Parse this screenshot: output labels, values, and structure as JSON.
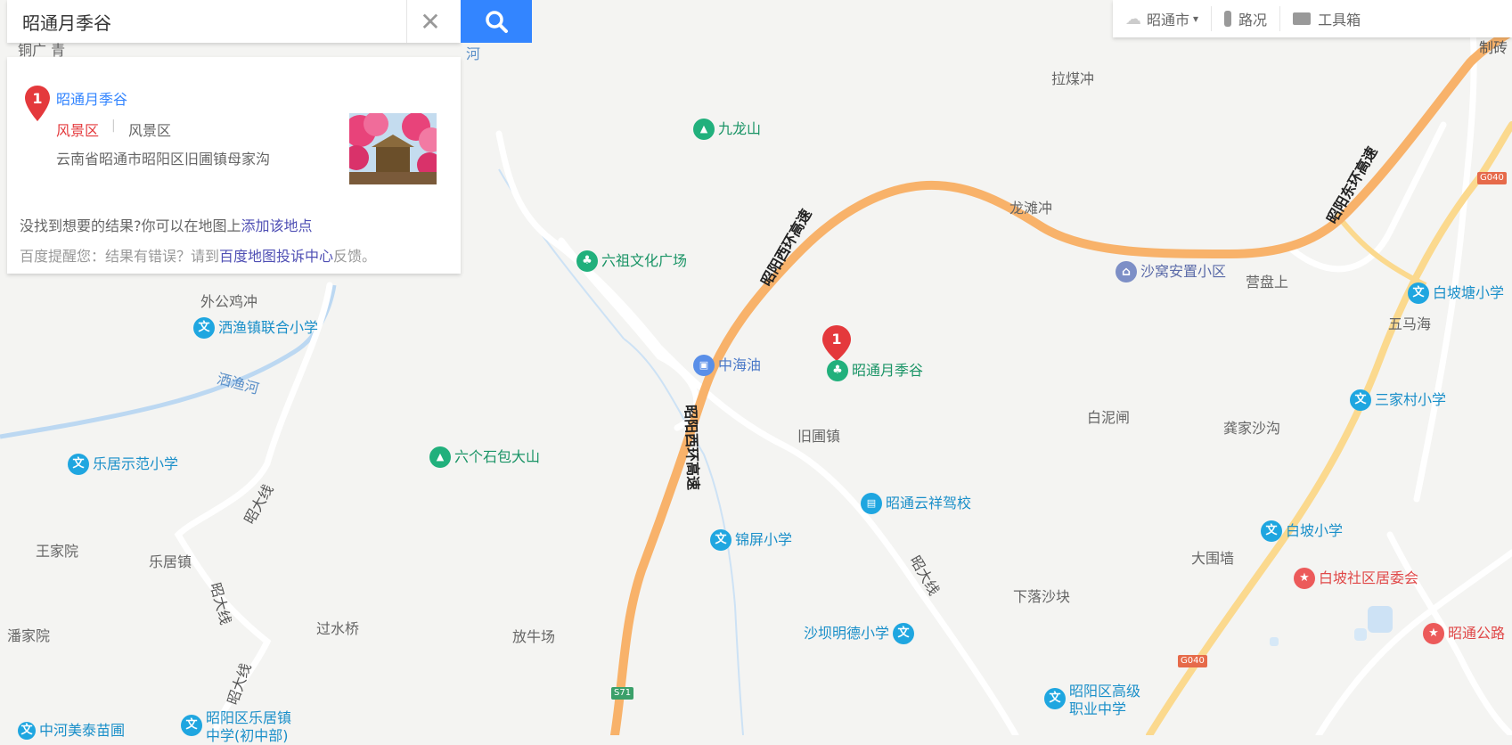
{
  "search": {
    "value": "昭通月季谷"
  },
  "result": {
    "marker": "1",
    "name": "昭通月季谷",
    "category_primary": "风景区",
    "separator": "|",
    "category_secondary": "风景区",
    "address": "云南省昭通市昭阳区旧圃镇母家沟",
    "hint1_prefix": "没找到想要的结果?你可以在地图上",
    "hint1_link": "添加该地点",
    "hint2_prefix": "百度提醒您：结果有错误？请到",
    "hint2_link": "百度地图投诉中心",
    "hint2_suffix": "反馈。"
  },
  "toolbar": {
    "city": "昭通市",
    "traffic": "路况",
    "tools": "工具箱"
  },
  "map_marker": {
    "number": "1",
    "label": "昭通月季谷"
  },
  "place_labels": {
    "tongguang": "铜广 青",
    "he": "河",
    "lameichong": "拉煤冲",
    "longtanchong": "龙滩冲",
    "yingpanshang": "营盘上",
    "wumahai": "五马海",
    "waigongjichong": "外公鸡冲",
    "saiyuhe": "洒渔河",
    "bainizha": "白泥闸",
    "gongjiashagou": "龚家沙沟",
    "jiupuzhen": "旧圃镇",
    "wangjiayuan": "王家院",
    "lejuzhen": "乐居镇",
    "panjiayuan": "潘家院",
    "guoshuiqiao": "过水桥",
    "fangniuchang": "放牛场",
    "dawei": "大围墙",
    "xialuoshakuai": "下落沙块",
    "zhiz": "制砖"
  },
  "pois": {
    "jiulongshan": "九龙山",
    "liuzu": "六祖文化广场",
    "shawo": "沙窝安置小区",
    "baipotang": "白坡塘小学",
    "saiyu_school": "洒渔镇联合小学",
    "zhonghaiyou": "中海油",
    "sanjiacun": "三家村小学",
    "leju_school": "乐居示范小学",
    "liugeshi": "六个石包大山",
    "yunxiang": "昭通云祥驾校",
    "baipo_school": "白坡小学",
    "jinping": "锦屏小学",
    "baipo_office": "白坡社区居委会",
    "zhaotong_road": "昭通公路",
    "shaba": "沙坝明德小学",
    "zhaoyang_vocational_1": "昭阳区高级",
    "zhaoyang_vocational_2": "职业中学",
    "leju_middle_1": "昭阳区乐居镇",
    "leju_middle_2": "中学(初中部)",
    "zhonghe": "中河美泰苗圃"
  },
  "roads": {
    "highway_west": "昭阳西环高速",
    "highway_east": "昭阳东环高速",
    "zhaoda": "昭大线",
    "shield_g040": "G040",
    "shield_s71": "S71"
  },
  "colors": {
    "highway": "#f8b26a",
    "national_road": "#fbd98e",
    "road": "#ffffff",
    "water": "#bcd8f2",
    "accent": "#3385ff"
  }
}
